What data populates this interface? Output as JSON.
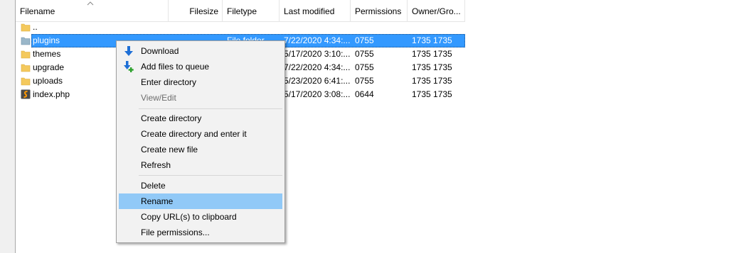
{
  "columns": {
    "filename": "Filename",
    "filesize": "Filesize",
    "filetype": "Filetype",
    "last_modified": "Last modified",
    "permissions": "Permissions",
    "owner_group": "Owner/Gro..."
  },
  "rows": [
    {
      "name": "..",
      "type": "",
      "modified": "",
      "perms": "",
      "owner": "",
      "icon": "folder-icon"
    },
    {
      "name": "plugins",
      "type": "File folder",
      "modified": "7/22/2020 4:34:...",
      "perms": "0755",
      "owner": "1735 1735",
      "icon": "folder-icon"
    },
    {
      "name": "themes",
      "type": "",
      "modified": "5/17/2020 3:10:...",
      "perms": "0755",
      "owner": "1735 1735",
      "icon": "folder-icon"
    },
    {
      "name": "upgrade",
      "type": "",
      "modified": "7/22/2020 4:34:...",
      "perms": "0755",
      "owner": "1735 1735",
      "icon": "folder-icon"
    },
    {
      "name": "uploads",
      "type": "",
      "modified": "5/23/2020 6:41:...",
      "perms": "0755",
      "owner": "1735 1735",
      "icon": "folder-icon"
    },
    {
      "name": "index.php",
      "type": "",
      "modified": "5/17/2020 3:08:...",
      "perms": "0644",
      "owner": "1735 1735",
      "icon": "php-file-icon"
    }
  ],
  "context_menu": {
    "download": "Download",
    "add_to_queue": "Add files to queue",
    "enter_directory": "Enter directory",
    "view_edit": "View/Edit",
    "create_directory": "Create directory",
    "create_directory_enter": "Create directory and enter it",
    "create_new_file": "Create new file",
    "refresh": "Refresh",
    "delete": "Delete",
    "rename": "Rename",
    "copy_urls": "Copy URL(s) to clipboard",
    "file_permissions": "File permissions..."
  },
  "colors": {
    "selection": "#3399ff",
    "menu_highlight": "#91c9f7",
    "folder": "#f4c95d"
  }
}
